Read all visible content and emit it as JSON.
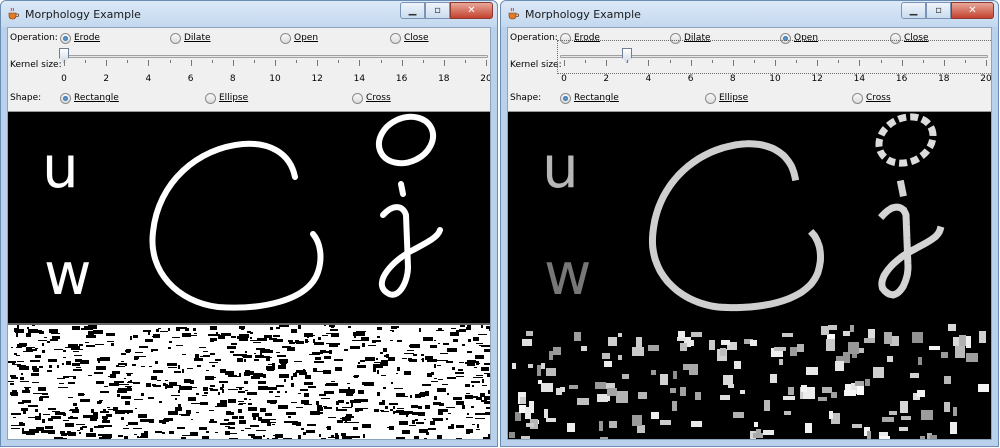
{
  "windows": [
    {
      "id": "left",
      "title": "Morphology Example",
      "operation_label": "Operation:",
      "operations": [
        "Erode",
        "Dilate",
        "Open",
        "Close"
      ],
      "selected_operation": "Erode",
      "kernel_label": "Kernel size:",
      "kernel_value": 0,
      "kernel_ticks": [
        "0",
        "2",
        "4",
        "6",
        "8",
        "10",
        "12",
        "14",
        "16",
        "18",
        "20"
      ],
      "shape_label": "Shape:",
      "shapes": [
        "Rectangle",
        "Ellipse",
        "Cross"
      ],
      "selected_shape": "Rectangle"
    },
    {
      "id": "right",
      "title": "Morphology Example",
      "operation_label": "Operation:",
      "operations": [
        "Erode",
        "Dilate",
        "Open",
        "Close"
      ],
      "selected_operation": "Open",
      "kernel_label": "Kernel size:",
      "kernel_value": 3,
      "kernel_ticks": [
        "0",
        "2",
        "4",
        "6",
        "8",
        "10",
        "12",
        "14",
        "16",
        "18",
        "20"
      ],
      "shape_label": "Shape:",
      "shapes": [
        "Rectangle",
        "Ellipse",
        "Cross"
      ],
      "selected_shape": "Rectangle"
    }
  ],
  "image_text": {
    "letter_u": "u",
    "letter_w": "w"
  },
  "icons": {
    "app": "java-coffee-cup-icon",
    "minimize": "minimize-icon",
    "maximize": "maximize-icon",
    "close": "close-icon"
  }
}
